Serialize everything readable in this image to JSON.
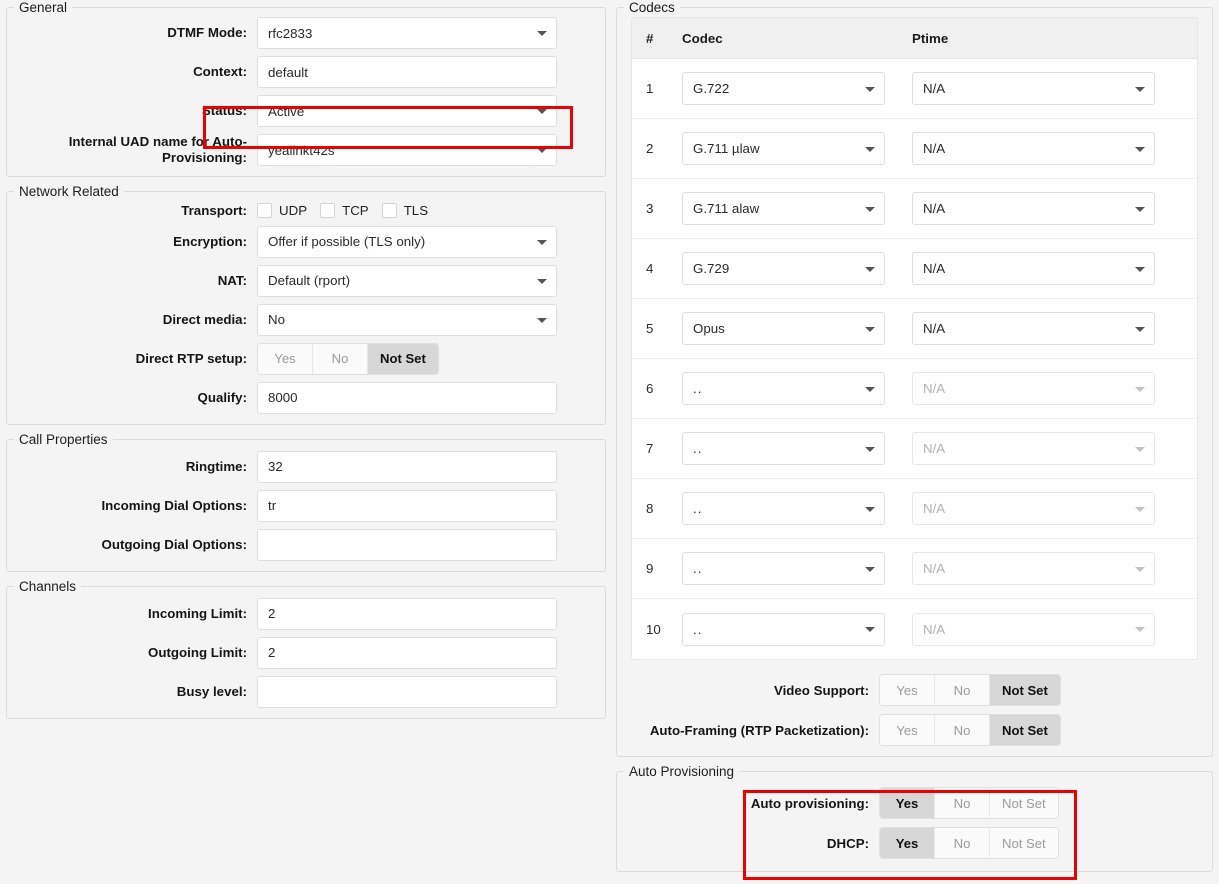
{
  "theme": {
    "page_bg": "#f4f4f4",
    "field_bg": "#ffffff",
    "border": "#dcdcdc",
    "label_color": "#151515",
    "active_segment_bg": "#d7d7d7",
    "muted_text": "#b2b2b2",
    "highlight_color": "#ef0000",
    "table_header_bg": "#f0f0f0"
  },
  "left": {
    "general": {
      "legend": "General",
      "dtmf_mode": {
        "label": "DTMF Mode:",
        "value": "rfc2833"
      },
      "context": {
        "label": "Context:",
        "value": "default"
      },
      "status": {
        "label": "Status:",
        "value": "Active"
      },
      "internal_uad": {
        "label": "Internal UAD name for Auto-Provisioning:",
        "value": "yealinkt42s"
      }
    },
    "network": {
      "legend": "Network Related",
      "transport": {
        "label": "Transport:",
        "options": [
          {
            "label": "UDP",
            "checked": false
          },
          {
            "label": "TCP",
            "checked": false
          },
          {
            "label": "TLS",
            "checked": false
          }
        ]
      },
      "encryption": {
        "label": "Encryption:",
        "value": "Offer if possible (TLS only)"
      },
      "nat": {
        "label": "NAT:",
        "value": "Default (rport)"
      },
      "direct_media": {
        "label": "Direct media:",
        "value": "No"
      },
      "direct_rtp_setup": {
        "label": "Direct RTP setup:",
        "options": [
          "Yes",
          "No",
          "Not Set"
        ],
        "selected": "Not Set"
      },
      "qualify": {
        "label": "Qualify:",
        "value": "8000"
      }
    },
    "call_properties": {
      "legend": "Call Properties",
      "ringtime": {
        "label": "Ringtime:",
        "value": "32"
      },
      "incoming_dial_options": {
        "label": "Incoming Dial Options:",
        "value": "tr"
      },
      "outgoing_dial_options": {
        "label": "Outgoing Dial Options:",
        "value": ""
      }
    },
    "channels": {
      "legend": "Channels",
      "incoming_limit": {
        "label": "Incoming Limit:",
        "value": "2"
      },
      "outgoing_limit": {
        "label": "Outgoing Limit:",
        "value": "2"
      },
      "busy_level": {
        "label": "Busy level:",
        "value": ""
      }
    }
  },
  "right": {
    "codecs": {
      "legend": "Codecs",
      "columns": [
        "#",
        "Codec",
        "Ptime"
      ],
      "rows": [
        {
          "num": "1",
          "codec": "G.722",
          "ptime": "N/A",
          "enabled": true
        },
        {
          "num": "2",
          "codec": "G.711 µlaw",
          "ptime": "N/A",
          "enabled": true
        },
        {
          "num": "3",
          "codec": "G.711 alaw",
          "ptime": "N/A",
          "enabled": true
        },
        {
          "num": "4",
          "codec": "G.729",
          "ptime": "N/A",
          "enabled": true
        },
        {
          "num": "5",
          "codec": "Opus",
          "ptime": "N/A",
          "enabled": true
        },
        {
          "num": "6",
          "codec": "..",
          "ptime": "N/A",
          "enabled": false
        },
        {
          "num": "7",
          "codec": "..",
          "ptime": "N/A",
          "enabled": false
        },
        {
          "num": "8",
          "codec": "..",
          "ptime": "N/A",
          "enabled": false
        },
        {
          "num": "9",
          "codec": "..",
          "ptime": "N/A",
          "enabled": false
        },
        {
          "num": "10",
          "codec": "..",
          "ptime": "N/A",
          "enabled": false
        }
      ],
      "video_support": {
        "label": "Video Support:",
        "options": [
          "Yes",
          "No",
          "Not Set"
        ],
        "selected": "Not Set"
      },
      "auto_framing": {
        "label": "Auto-Framing (RTP Packetization):",
        "options": [
          "Yes",
          "No",
          "Not Set"
        ],
        "selected": "Not Set"
      }
    },
    "auto_provisioning": {
      "legend": "Auto Provisioning",
      "auto_provisioning": {
        "label": "Auto provisioning:",
        "options": [
          "Yes",
          "No",
          "Not Set"
        ],
        "selected": "Yes"
      },
      "dhcp": {
        "label": "DHCP:",
        "options": [
          "Yes",
          "No",
          "Not Set"
        ],
        "selected": "Yes"
      }
    }
  }
}
